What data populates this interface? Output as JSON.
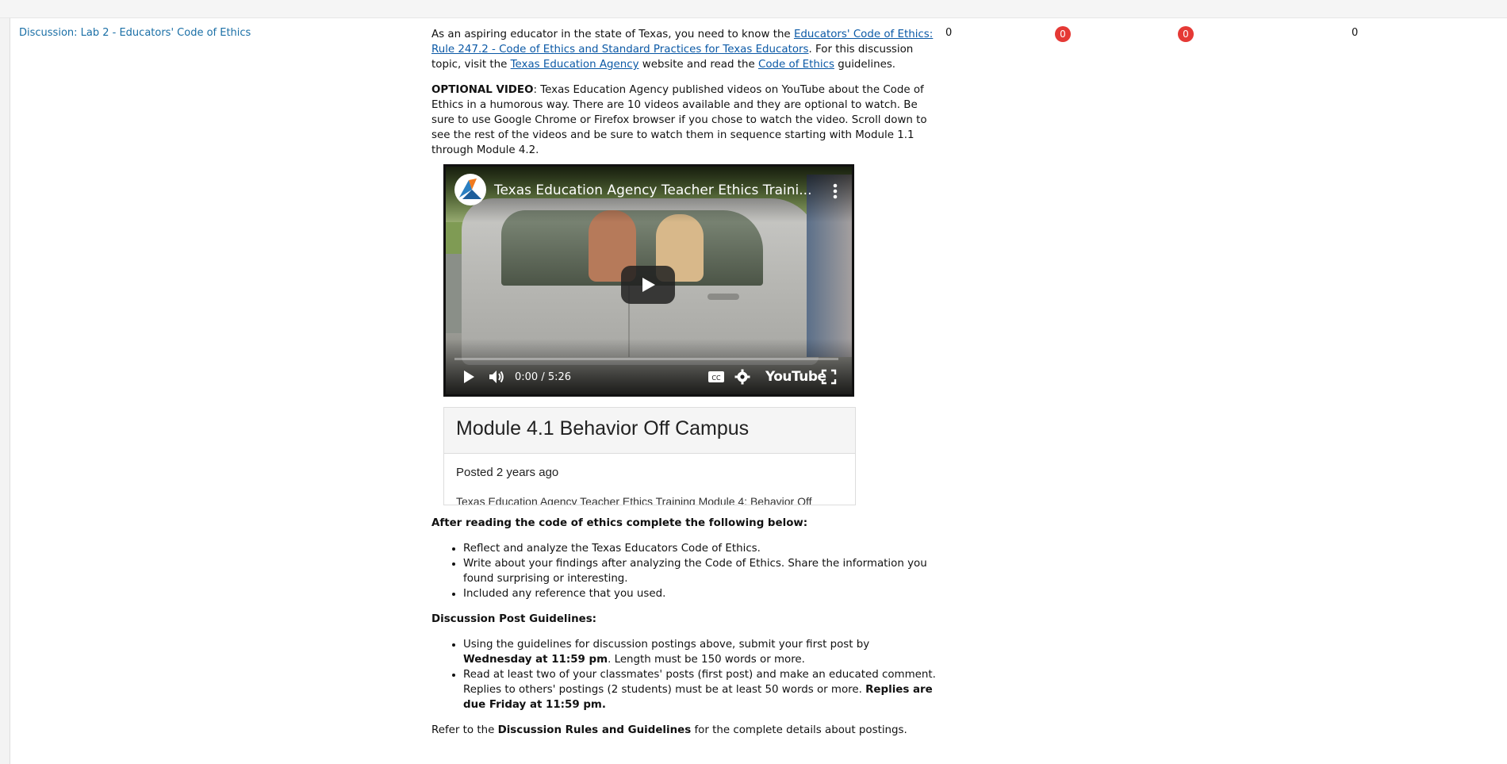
{
  "row": {
    "title": "Discussion: Lab 2 - Educators' Code of Ethics",
    "col_topics": "0",
    "badge_unread_posts": "0",
    "badge_unread_replies": "0",
    "col_last": "0"
  },
  "description": {
    "intro_1": "As an aspiring educator in the state of Texas, you need to know the ",
    "link_rule": "Educators' Code of Ethics: Rule 247.2 - Code of Ethics and Standard Practices for Texas Educators",
    "intro_2": ". For this discussion topic, visit the ",
    "link_tea": "Texas Education Agency",
    "intro_3": " website and read the ",
    "link_coe": "Code of Ethics",
    "intro_4": " guidelines.",
    "optional_label": "OPTIONAL VIDEO",
    "optional_text": ": Texas Education Agency published videos on YouTube about the Code of Ethics in a humorous way. There are 10 videos available and they are optional to watch. Be sure to use Google Chrome or Firefox browser if you chose to watch the video. Scroll down to see the rest of the videos and be sure to watch them in sequence starting with Module 1.1 through Module 4.2."
  },
  "video": {
    "title": "Texas Education Agency Teacher Ethics Traini...",
    "time": "0:00 / 5:26",
    "brand": "YouTube",
    "icons": [
      "channel-logo-icon",
      "more-vert-icon",
      "play-button-icon",
      "play-icon",
      "volume-icon",
      "cc-icon",
      "settings-icon",
      "fullscreen-icon"
    ]
  },
  "preview": {
    "title": "Module 4.1 Behavior Off Campus",
    "posted": "Posted 2 years ago",
    "excerpt": "Texas Education Agency Teacher Ethics Training Module 4: Behavior Off"
  },
  "instructions": {
    "heading": "After reading the code of ethics complete the following below:",
    "items": [
      "Reflect and analyze the Texas Educators Code of Ethics.",
      "Write about your findings after analyzing the Code of Ethics. Share the information you found surprising or interesting.",
      "Included any reference that you used."
    ]
  },
  "guidelines": {
    "heading": "Discussion Post Guidelines:",
    "item1_a": "Using the guidelines for discussion postings above, submit your first post by ",
    "item1_b": "Wednesday at 11:59 pm",
    "item1_c": ". Length must be 150 words or more.",
    "item2_a": "Read at least two of your classmates' posts (first post) and make an educated comment. Replies to others' postings (2 students) must be at least 50 words or more. ",
    "item2_b": "Replies are due Friday at 11:59 pm.",
    "refer_a": "Refer to the ",
    "refer_b": "Discussion Rules and Guidelines",
    "refer_c": " for the complete details about postings."
  },
  "colors": {
    "link": "#1a6fa6",
    "badge": "#e53935"
  }
}
